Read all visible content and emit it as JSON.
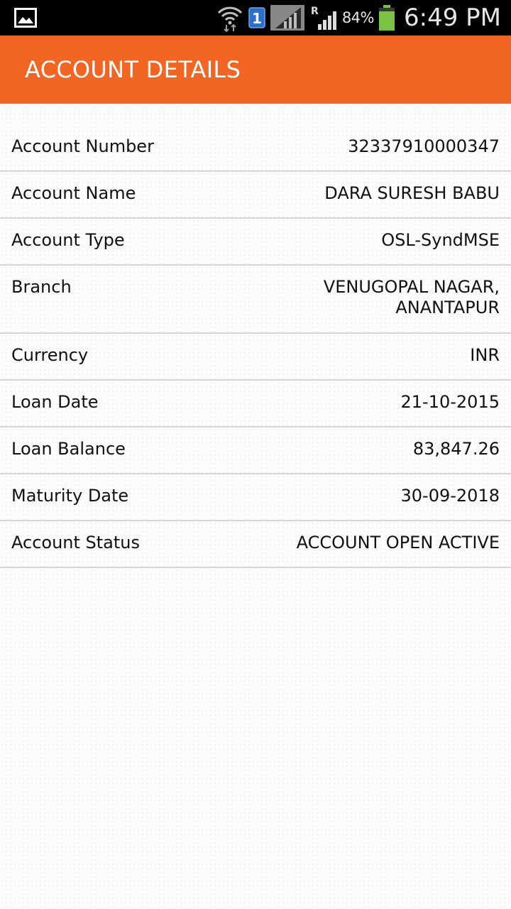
{
  "status_bar": {
    "battery_percent": "84%",
    "time": "6:49 PM",
    "icons": [
      "image-notification-icon",
      "wifi-icon",
      "sim1-icon",
      "signal-icon",
      "roaming-signal-icon",
      "battery-icon"
    ],
    "battery_level": 0.84,
    "colors": {
      "background": "#000000",
      "battery": "#7cc242"
    }
  },
  "app_bar": {
    "title": "ACCOUNT DETAILS",
    "color": "#f26522"
  },
  "details": [
    {
      "label": "Account Number",
      "value": "32337910000347"
    },
    {
      "label": "Account Name",
      "value": "DARA SURESH BABU"
    },
    {
      "label": "Account Type",
      "value": "OSL-SyndMSE"
    },
    {
      "label": "Branch",
      "value_lines": [
        "VENUGOPAL NAGAR,",
        "ANANTAPUR"
      ]
    },
    {
      "label": "Currency",
      "value": "INR"
    },
    {
      "label": "Loan Date",
      "value": "21-10-2015"
    },
    {
      "label": "Loan Balance",
      "value": "83,847.26"
    },
    {
      "label": "Maturity Date",
      "value": "30-09-2018"
    },
    {
      "label": "Account Status",
      "value": "ACCOUNT OPEN ACTIVE"
    }
  ]
}
